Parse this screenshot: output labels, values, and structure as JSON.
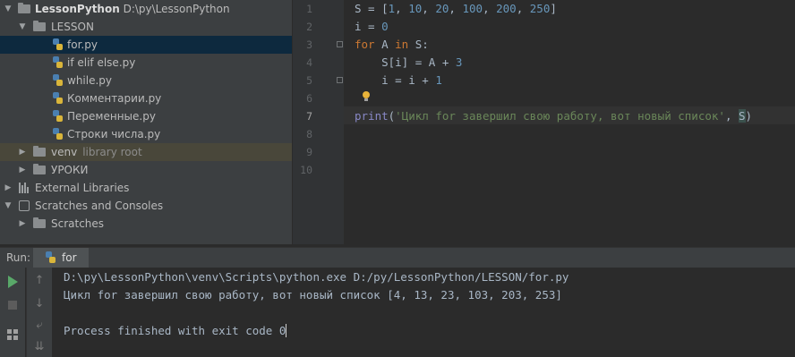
{
  "tree": {
    "project": {
      "name": "LessonPython",
      "path": "D:\\py\\LessonPython"
    },
    "lesson_folder": "LESSON",
    "files": [
      "for.py",
      "if elif else.py",
      "while.py",
      "Комментарии.py",
      "Переменные.py",
      "Строки числа.py"
    ],
    "venv": {
      "name": "venv",
      "note": "library root"
    },
    "lessons_folder": "УРОКИ",
    "external_libraries": "External Libraries",
    "scratches_and_consoles": "Scratches and Consoles",
    "scratches": "Scratches"
  },
  "editor": {
    "line_numbers": [
      "1",
      "2",
      "3",
      "4",
      "5",
      "6",
      "7",
      "8",
      "9",
      "10"
    ],
    "current_line": "7",
    "lines": [
      "S = [1, 10, 20, 100, 200, 250]",
      "i = 0",
      "for A in S:",
      "    S[i] = A + 3",
      "    i = i + 1",
      "",
      "print('Цикл for завершил свою работу, вот новый список', S)"
    ]
  },
  "run": {
    "label": "Run:",
    "tab": "for",
    "output": [
      "D:\\py\\LessonPython\\venv\\Scripts\\python.exe D:/py/LessonPython/LESSON/for.py",
      "Цикл for завершил свою работу, вот новый список [4, 13, 23, 103, 203, 253]",
      "",
      "Process finished with exit code 0"
    ]
  }
}
